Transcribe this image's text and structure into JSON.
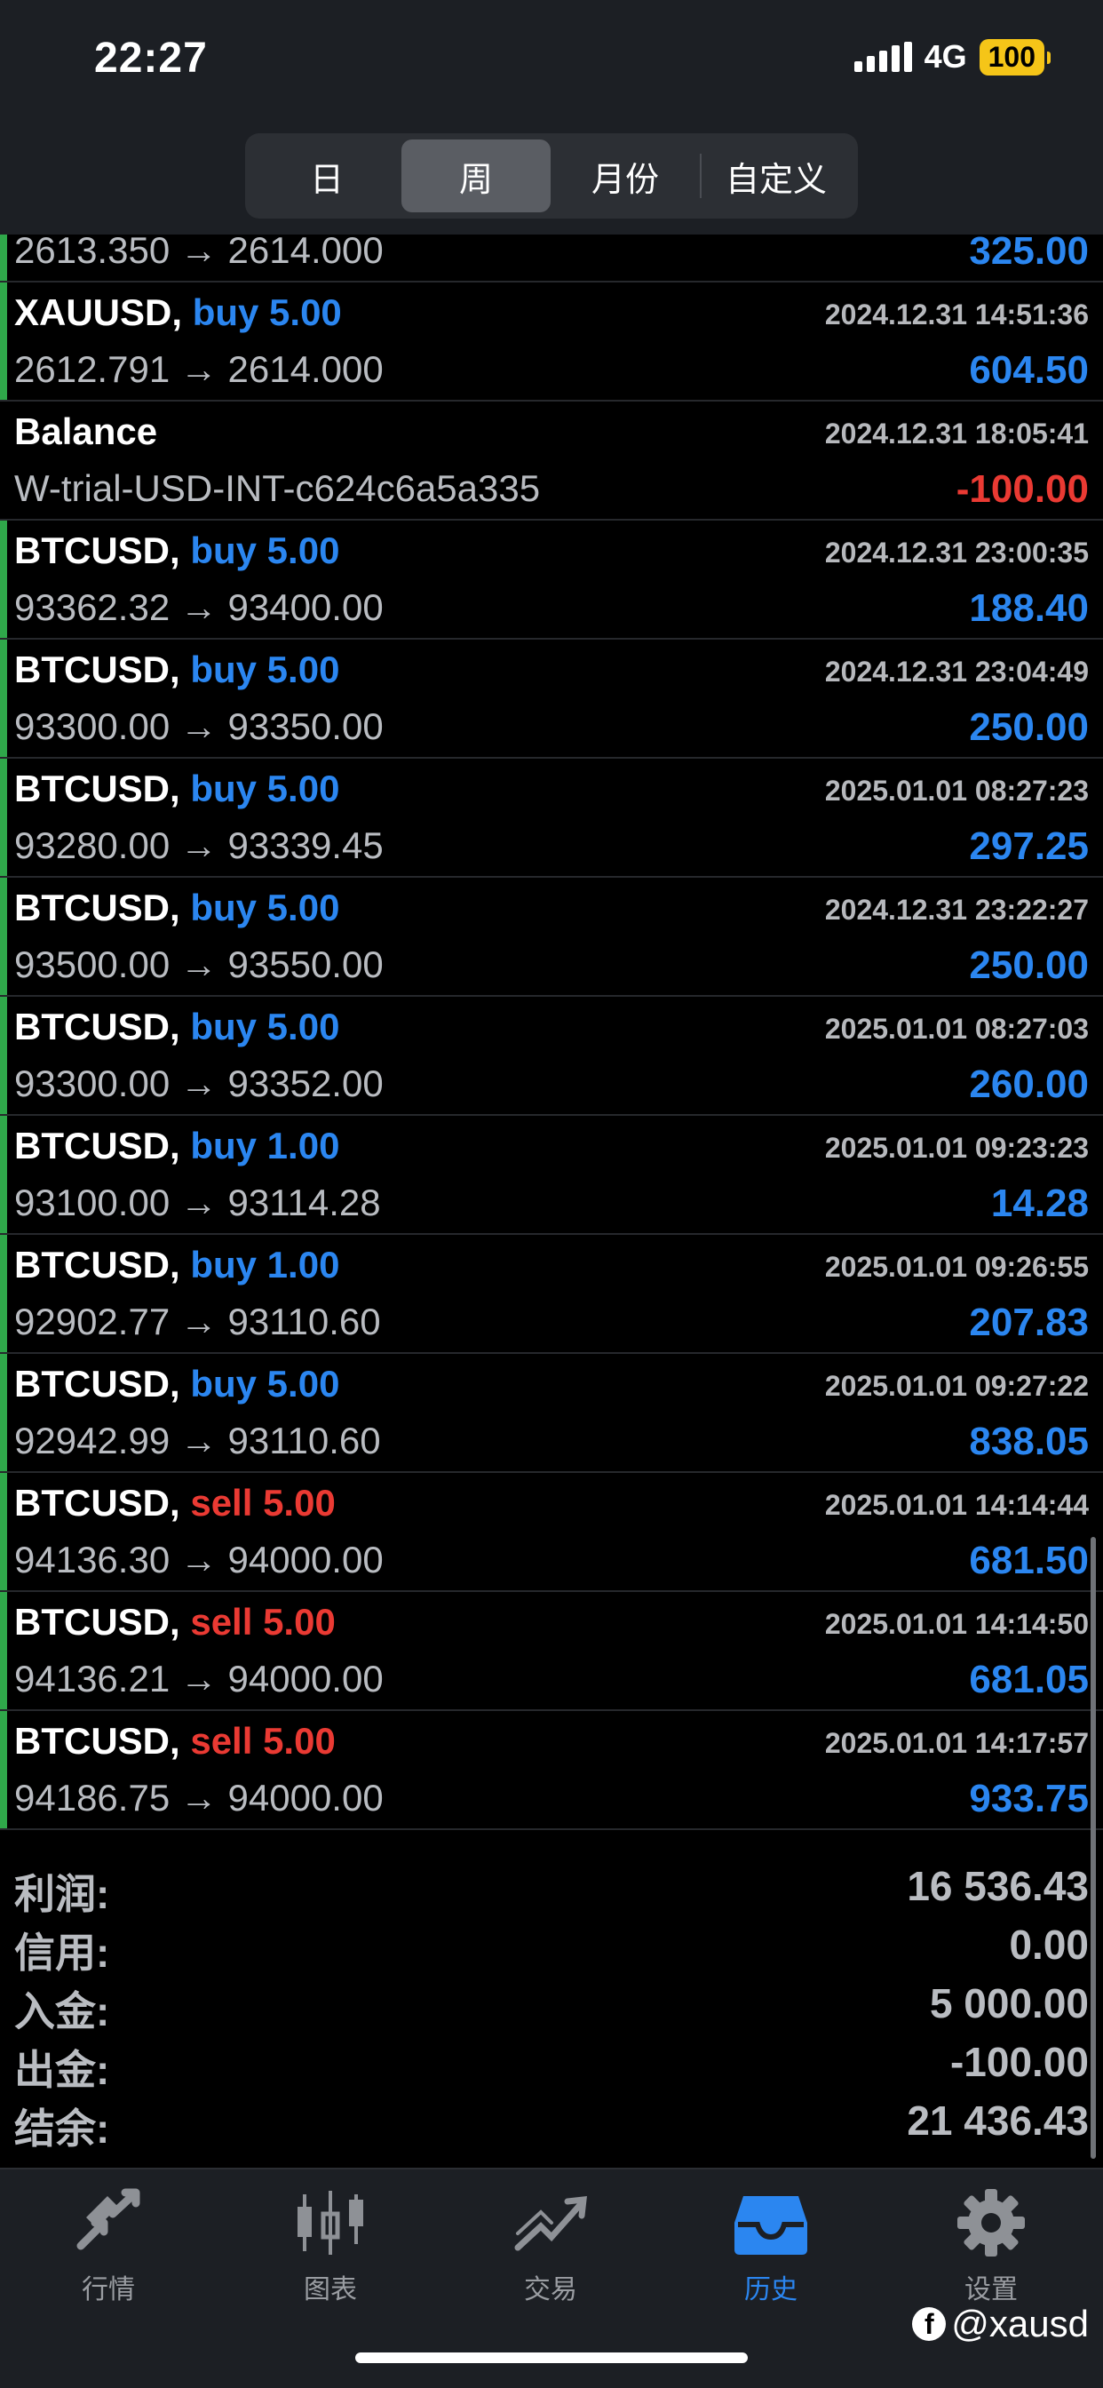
{
  "status": {
    "time": "22:27",
    "network": "4G",
    "battery": "100"
  },
  "segments": [
    {
      "label": "日",
      "active": false
    },
    {
      "label": "周",
      "active": true
    },
    {
      "label": "月份",
      "active": false
    },
    {
      "label": "自定义",
      "active": false
    }
  ],
  "partial_row": {
    "prices": "2613.350 → 2614.000",
    "profit": "325.00"
  },
  "rows": [
    {
      "title": "XAUUSD,",
      "side": "buy 5.00",
      "sideType": "buy",
      "datetime": "2024.12.31 14:51:36",
      "prices": "2612.791 → 2614.000",
      "profit": "604.50",
      "neg": false
    },
    {
      "title": "Balance",
      "side": "",
      "sideType": "none",
      "datetime": "2024.12.31 18:05:41",
      "prices": "W-trial-USD-INT-c624c6a5a335",
      "profit": "-100.00",
      "neg": true
    },
    {
      "title": "BTCUSD,",
      "side": "buy 5.00",
      "sideType": "buy",
      "datetime": "2024.12.31 23:00:35",
      "prices": "93362.32 → 93400.00",
      "profit": "188.40",
      "neg": false
    },
    {
      "title": "BTCUSD,",
      "side": "buy 5.00",
      "sideType": "buy",
      "datetime": "2024.12.31 23:04:49",
      "prices": "93300.00 → 93350.00",
      "profit": "250.00",
      "neg": false
    },
    {
      "title": "BTCUSD,",
      "side": "buy 5.00",
      "sideType": "buy",
      "datetime": "2025.01.01 08:27:23",
      "prices": "93280.00 → 93339.45",
      "profit": "297.25",
      "neg": false
    },
    {
      "title": "BTCUSD,",
      "side": "buy 5.00",
      "sideType": "buy",
      "datetime": "2024.12.31 23:22:27",
      "prices": "93500.00 → 93550.00",
      "profit": "250.00",
      "neg": false
    },
    {
      "title": "BTCUSD,",
      "side": "buy 5.00",
      "sideType": "buy",
      "datetime": "2025.01.01 08:27:03",
      "prices": "93300.00 → 93352.00",
      "profit": "260.00",
      "neg": false
    },
    {
      "title": "BTCUSD,",
      "side": "buy 1.00",
      "sideType": "buy",
      "datetime": "2025.01.01 09:23:23",
      "prices": "93100.00 → 93114.28",
      "profit": "14.28",
      "neg": false
    },
    {
      "title": "BTCUSD,",
      "side": "buy 1.00",
      "sideType": "buy",
      "datetime": "2025.01.01 09:26:55",
      "prices": "92902.77 → 93110.60",
      "profit": "207.83",
      "neg": false
    },
    {
      "title": "BTCUSD,",
      "side": "buy 5.00",
      "sideType": "buy",
      "datetime": "2025.01.01 09:27:22",
      "prices": "92942.99 → 93110.60",
      "profit": "838.05",
      "neg": false
    },
    {
      "title": "BTCUSD,",
      "side": "sell 5.00",
      "sideType": "sell",
      "datetime": "2025.01.01 14:14:44",
      "prices": "94136.30 → 94000.00",
      "profit": "681.50",
      "neg": false
    },
    {
      "title": "BTCUSD,",
      "side": "sell 5.00",
      "sideType": "sell",
      "datetime": "2025.01.01 14:14:50",
      "prices": "94136.21 → 94000.00",
      "profit": "681.05",
      "neg": false
    },
    {
      "title": "BTCUSD,",
      "side": "sell 5.00",
      "sideType": "sell",
      "datetime": "2025.01.01 14:17:57",
      "prices": "94186.75 → 94000.00",
      "profit": "933.75",
      "neg": false
    }
  ],
  "summary": [
    {
      "label": "利润:",
      "value": "16 536.43"
    },
    {
      "label": "信用:",
      "value": "0.00"
    },
    {
      "label": "入金:",
      "value": "5 000.00"
    },
    {
      "label": "出金:",
      "value": "-100.00"
    },
    {
      "label": "结余:",
      "value": "21 436.43"
    }
  ],
  "tabs": [
    {
      "label": "行情",
      "icon": "quotes-arrows-icon",
      "active": false
    },
    {
      "label": "图表",
      "icon": "candlestick-chart-icon",
      "active": false
    },
    {
      "label": "交易",
      "icon": "trade-trend-icon",
      "active": false
    },
    {
      "label": "历史",
      "icon": "history-inbox-icon",
      "active": true
    },
    {
      "label": "设置",
      "icon": "gear-icon",
      "active": false
    }
  ],
  "watermark": "@xausd",
  "watermark_icon_letter": "f",
  "colors": {
    "buy": "#2b86f0",
    "sell": "#ea3a33",
    "accent_green": "#2fa84a",
    "active_tab": "#2b86f0"
  }
}
